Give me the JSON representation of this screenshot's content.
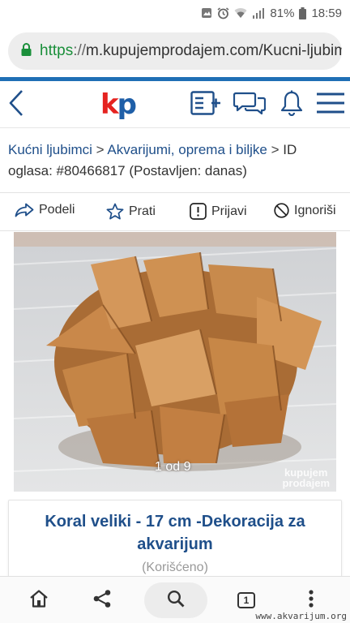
{
  "status_bar": {
    "battery_percent": "81%",
    "time": "18:59"
  },
  "browser": {
    "url_scheme": "https",
    "url_sep": "://",
    "url_rest": "m.kupujemprodajem.com/Kucni-ljubimci"
  },
  "app_header": {
    "logo_k": "k",
    "logo_p": "p"
  },
  "breadcrumb": {
    "items": [
      "Kućni ljubimci",
      "Akvarijumi, oprema i biljke"
    ],
    "separator": ">",
    "id_text": "ID oglasa: #80466817 (Postavljen: danas)"
  },
  "actions": {
    "share": "Podeli",
    "follow": "Prati",
    "report": "Prijavi",
    "ignore": "Ignoriši"
  },
  "photo": {
    "counter": "1 od 9",
    "watermark_line1": "kupujem",
    "watermark_line2": "prodajem"
  },
  "listing": {
    "title": "Koral veliki - 17 cm -Dekoracija za akvarijum",
    "condition": "(Korišćeno)"
  },
  "bottom_nav": {
    "tab_count": "1"
  },
  "corner_watermark": "www.akvarijum.org",
  "colors": {
    "brand_blue": "#1f4f8a",
    "accent_blue_rule": "#1f6fb5",
    "logo_red": "#e52320",
    "secure_green": "#1a8f3a"
  }
}
